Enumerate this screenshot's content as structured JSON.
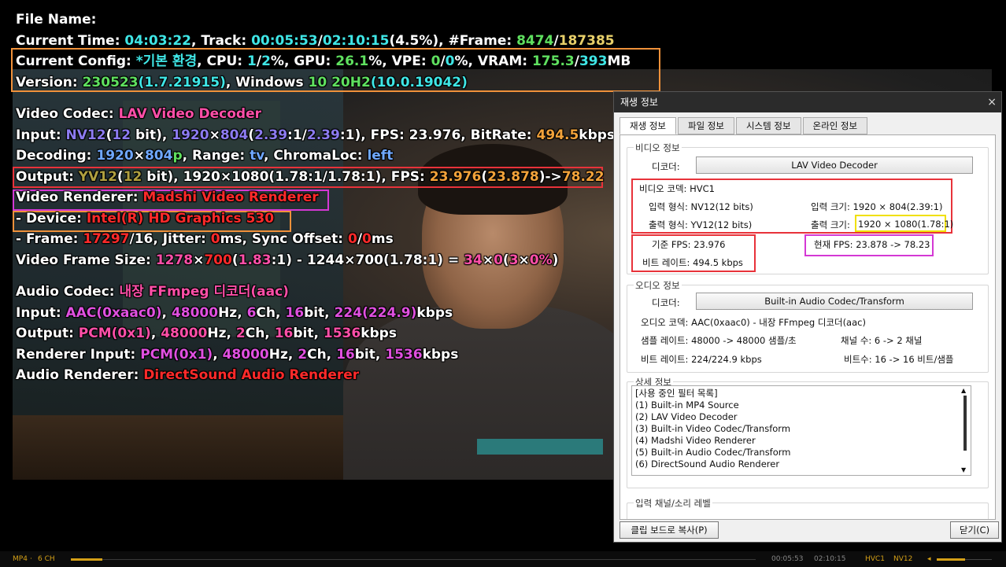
{
  "osd": {
    "file_name_label": "File Name:",
    "current_time": {
      "label": "Current Time: ",
      "time": "04:03:22",
      "track_label": ", Track: ",
      "track_pos": "00:05:53",
      "sep": "/",
      "track_total": "02:10:15",
      "pct": "(4.5%)",
      "frame_label": ", #Frame: ",
      "frame": "8474",
      "frame_sep": "/",
      "frame_total": "187385"
    },
    "config": {
      "label": "Current Config: ",
      "name": "*기본 환경",
      "cpu_label": ", CPU: ",
      "cpu_a": "1",
      "cpu_sep": "/",
      "cpu_b": "2",
      "cpu_unit": "%",
      "gpu_label": ", GPU: ",
      "gpu": "26.1",
      "gpu_unit": "%",
      "vpe_label": ", VPE: ",
      "vpe_a": "0",
      "vpe_sep": "/",
      "vpe_b": "0",
      "vpe_unit": "%",
      "vram_label": ", VRAM: ",
      "vram_a": "175.3",
      "vram_sep": "/",
      "vram_b": "393",
      "vram_unit": "MB"
    },
    "version": {
      "label": "Version: ",
      "build": "230523",
      "detail": "(1.7.21915)",
      "os_label": ", Windows ",
      "os_ver": "10",
      "os_rel": " 20H2",
      "os_build": "(10.0.19042)"
    },
    "video_codec": {
      "label": "Video Codec: ",
      "value": "LAV Video Decoder"
    },
    "input": {
      "label": "Input: ",
      "fmt": "NV12",
      "bits_open": "(",
      "bits": "12",
      "bits_close": " bit), ",
      "res": "1920",
      "x": "×",
      "resh": "804",
      "ar_open": "(",
      "ar1": "2.39",
      "ar_colon1": ":1/",
      "ar2": "2.39",
      "ar_colon2": ":1",
      "ar_close": "), FPS: ",
      "fps": "23.976",
      "br_label": ", BitRate: ",
      "br": "494.5",
      "br_unit": "kbps"
    },
    "decoding": {
      "label": "Decoding: ",
      "w": "1920",
      "x": "×",
      "h": "804",
      "p": "p",
      "range_label": ", Range: ",
      "range": "tv",
      "chroma_label": ", ChromaLoc: ",
      "chroma": "left"
    },
    "output": {
      "label": "Output: ",
      "fmt": "YV12",
      "bits_open": "(",
      "bits": "12",
      "bits_close": " bit), 1920×1080(1.78:1/1.78:1), FPS: ",
      "fps": "23.976",
      "fps2_open": "(",
      "fps2": "23.878",
      "fps2_close": ")->",
      "fps3": "78.22"
    },
    "renderer": {
      "label": "Video Renderer: ",
      "value": "Madshi Video Renderer"
    },
    "device": {
      "label": " - Device: ",
      "value": "Intel(R) HD Graphics 530"
    },
    "frame": {
      "label": " - Frame: ",
      "a": "17297",
      "sep": "/16, Jitter: ",
      "jit": "0",
      "jit_unit": "ms, Sync Offset: ",
      "so_a": "0",
      "so_sep": "/",
      "so_b": "0",
      "so_unit": "ms"
    },
    "vframe": {
      "label": "Video Frame Size: ",
      "w": "1278",
      "x": "×",
      "h": "700",
      "ar_open": "(",
      "ar": "1.83",
      "ar_close": ":1) - ",
      "w2": "1244",
      "x2": "×",
      "h2": "700",
      "ar2_open": "(",
      "ar2": "1.78",
      "ar2_close": ":1) = ",
      "d1": "34",
      "x3": "×",
      "d2": "0",
      "p_open": "(",
      "p1": "3",
      "p_x": "×",
      "p2": "0%",
      "p_close": ")"
    },
    "audio_codec": {
      "label": "Audio Codec: ",
      "value": "내장 FFmpeg 디코더(aac)"
    },
    "a_input": {
      "label": "Input: ",
      "fmt": "AAC",
      "id": "(0xaac0)",
      "sep1": ", ",
      "hz": "48000",
      "hz_unit": "Hz, ",
      "ch": "6",
      "ch_unit": "Ch, ",
      "bit": "16",
      "bit_unit": "bit, ",
      "br": "224",
      "br2": "(224.9)",
      "br_unit": "kbps"
    },
    "a_output": {
      "label": "Output: ",
      "fmt": "PCM",
      "id": "(0x1)",
      "sep1": ", ",
      "hz": "48000",
      "hz_unit": "Hz, ",
      "ch": "2",
      "ch_unit": "Ch, ",
      "bit": "16",
      "bit_unit": "bit, ",
      "br": "1536",
      "br_unit": "kbps"
    },
    "r_input": {
      "label": "Renderer Input: ",
      "fmt": "PCM(0x1)",
      "sep1": ", ",
      "hz": "48000",
      "hz_unit": "Hz, ",
      "ch": "2",
      "ch_unit": "Ch, ",
      "bit": "16",
      "bit_unit": "bit, ",
      "br": "1536",
      "br_unit": "kbps"
    },
    "a_renderer": {
      "label": "Audio Renderer: ",
      "value": "DirectSound Audio Renderer"
    }
  },
  "dialog": {
    "title": "재생 정보",
    "close_glyph": "×",
    "tabs": [
      "재생 정보",
      "파일 정보",
      "시스템 정보",
      "온라인 정보"
    ],
    "video_group": "비디오 정보",
    "decoder_label": "디코더:",
    "video_decoder": "LAV Video Decoder",
    "video_codec": "비디오 코덱: HVC1",
    "in_fmt": "입력 형식: NV12(12 bits)",
    "in_size": "입력 크기: 1920 × 804(2.39:1)",
    "out_fmt": "출력 형식: YV12(12 bits)",
    "out_size_label": "출력 크기:",
    "out_size": "1920 × 1080(1.78:1)",
    "base_fps": "기준 FPS: 23.976",
    "cur_fps": "현재 FPS: 23.878 -> 78.23",
    "bitrate": "비트 레이트: 494.5 kbps",
    "audio_group": "오디오 정보",
    "audio_decoder": "Built-in Audio Codec/Transform",
    "audio_codec": "오디오 코덱: AAC(0xaac0) - 내장 FFmpeg 디코더(aac)",
    "sample_rate": "샘플 레이트: 48000 -> 48000 샘플/초",
    "channels": "채널 수: 6 -> 2 채널",
    "a_bitrate": "비트 레이트: 224/224.9 kbps",
    "bits": "비트수: 16 -> 16 비트/샘플",
    "detail_group": "상세 정보",
    "filters": [
      "[사용 중인 필터 목록]",
      " (1) Built-in MP4 Source",
      " (2) LAV Video Decoder",
      " (3) Built-in Video Codec/Transform",
      " (4) Madshi Video Renderer",
      " (5) Built-in Audio Codec/Transform",
      " (6) DirectSound Audio Renderer"
    ],
    "level_group": "입력 채널/소리 레벨",
    "copy_button": "클립 보드로 복사(P)",
    "close_button": "닫기(C)"
  },
  "status": {
    "container": "MP4",
    "dot1": "·",
    "channels": "6 CH",
    "pos": "00:05:53",
    "sep": "02:10:15",
    "codec": "HVC1",
    "fmt": "NV12",
    "colors": {
      "accent": "#d4a017"
    }
  }
}
